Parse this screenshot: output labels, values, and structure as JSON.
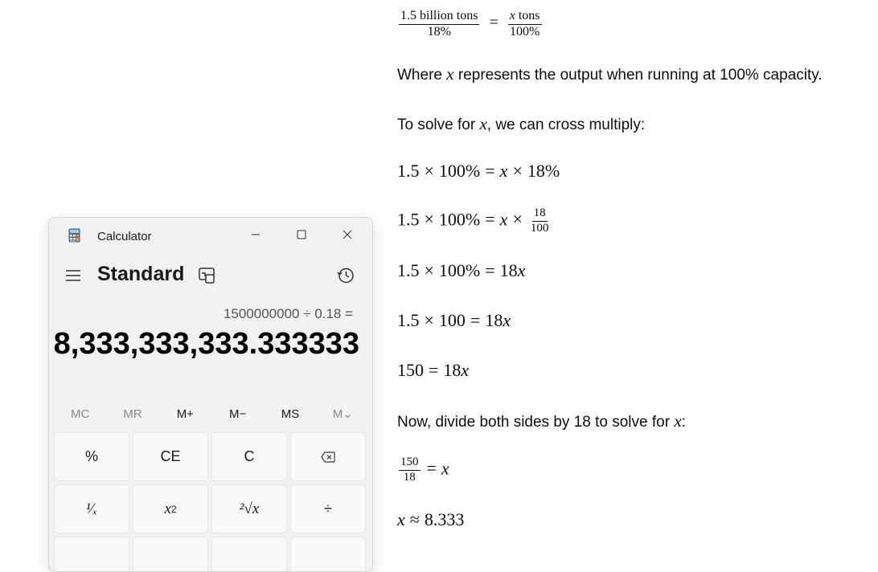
{
  "doc": {
    "eq_ratio": {
      "left_num": "1.5 billion tons",
      "left_den": "18%",
      "eq": "=",
      "right_num_var": "x",
      "right_num_unit": " tons",
      "right_den": "100%"
    },
    "where": {
      "pre": "Where ",
      "var": "x",
      "post": " represents the output when running at 100% capacity."
    },
    "solve": {
      "pre": "To solve for ",
      "var": "x",
      "post": ", we can cross multiply:"
    },
    "eq1": {
      "a": "1.5",
      "times": "×",
      "b": "100%",
      "eq": "=",
      "x": "x",
      "times2": "×",
      "c": "18%"
    },
    "eq2": {
      "a": "1.5",
      "times": "×",
      "b": "100%",
      "eq": "=",
      "x": "x",
      "times2": "×",
      "num": "18",
      "den": "100"
    },
    "eq3": {
      "a": "1.5",
      "times": "×",
      "b": "100%",
      "eq": "=",
      "c": "18",
      "x": "x"
    },
    "eq4": {
      "a": "1.5",
      "times": "×",
      "b": "100",
      "eq": "=",
      "c": "18",
      "x": "x"
    },
    "eq5": {
      "a": "150",
      "eq": "=",
      "c": "18",
      "x": "x"
    },
    "divide": {
      "pre": "Now, divide both sides by 18 to solve for ",
      "var": "x",
      "post": ":"
    },
    "eq6": {
      "num": "150",
      "den": "18",
      "eq": "=",
      "x": "x"
    },
    "eq7": {
      "x": "x",
      "approx": "≈",
      "val": "8.333"
    }
  },
  "calculator": {
    "title": "Calculator",
    "mode": "Standard",
    "expression": "1500000000 ÷ 0.18 =",
    "result": "8,333,333,333.333333",
    "memory": [
      "MC",
      "MR",
      "M+",
      "M−",
      "MS",
      "M⌄"
    ],
    "keys_row1": [
      "%",
      "CE",
      "C",
      "⌫"
    ],
    "keys_row2": {
      "recip": "¹⁄ₓ",
      "square_base": "x",
      "square_exp": "2",
      "root": "²√x",
      "divide": "÷"
    },
    "colors": {
      "window_bg": "#f2f2f2",
      "key_bg": "#f9f9f9",
      "text": "#1a1a1a"
    }
  }
}
